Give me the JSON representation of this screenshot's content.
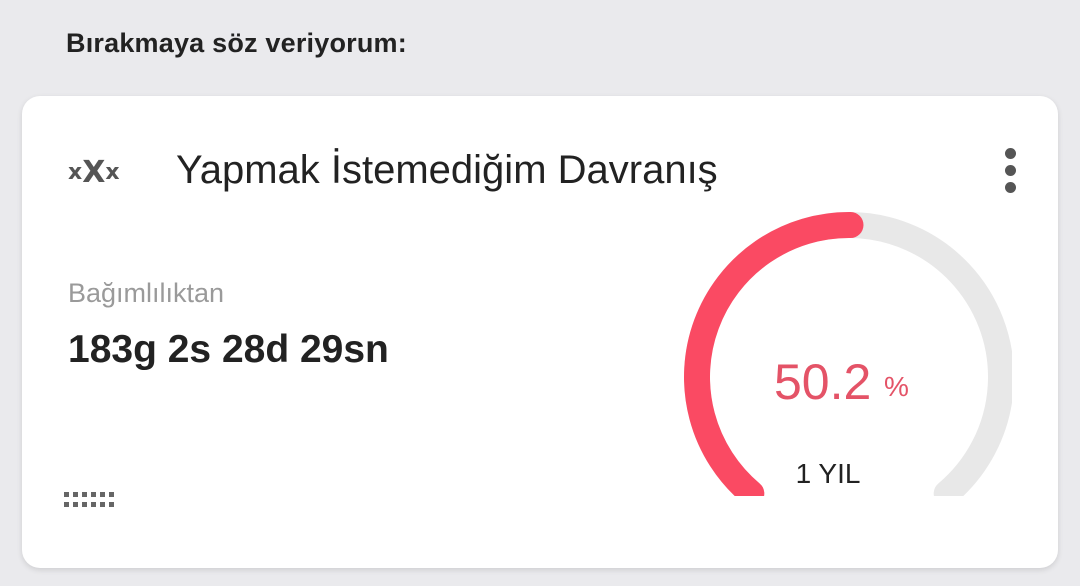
{
  "section": {
    "heading": "Bırakmaya söz veriyorum:"
  },
  "card": {
    "icon_name": "xxx-icon",
    "icon_text": {
      "left": "x",
      "center": "X",
      "right": "x"
    },
    "title": "Yapmak İstemediğim Davranış",
    "more_icon": "more-vertical-icon",
    "since_label": "Bağımlılıktan",
    "elapsed": "183g 2s 28d 29sn",
    "drag_icon": "drag-handle-icon",
    "progress": {
      "percent": 50.2,
      "value_text": "50.2",
      "unit": "%",
      "goal_label": "1 YIL",
      "progress_color": "#fa4a63",
      "track_color": "#e8e8e8"
    }
  }
}
